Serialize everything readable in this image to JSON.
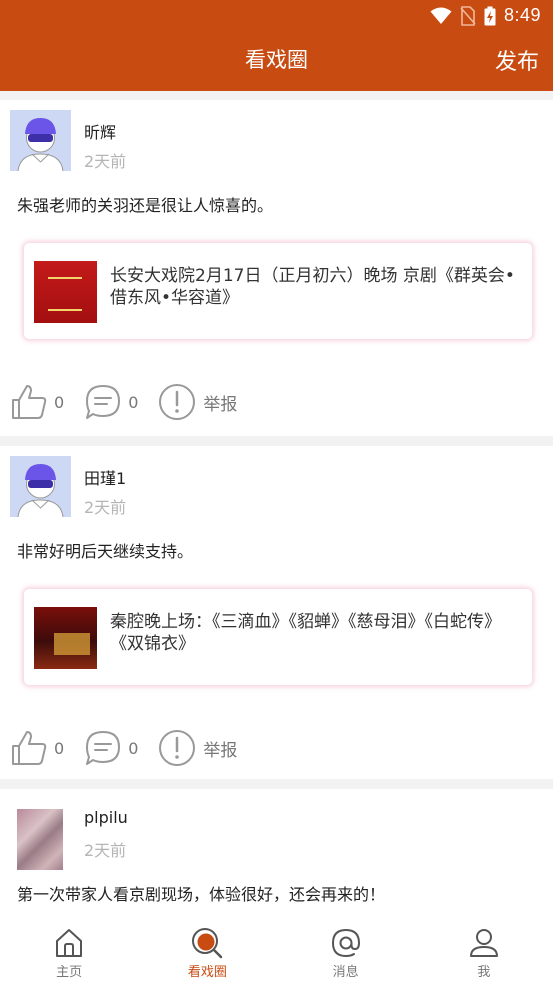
{
  "status_bar": {
    "time": "8:49"
  },
  "header": {
    "title": "看戏圈",
    "publish_label": "发布"
  },
  "posts": [
    {
      "username": "昕辉",
      "time_ago": "2天前",
      "content": "朱强老师的关羽还是很让人惊喜的。",
      "card_text": "长安大戏院2月17日（正月初六）晚场 京剧《群英会•借东风•华容道》",
      "likes": "0",
      "comments": "0",
      "report_label": "举报"
    },
    {
      "username": "田瑾1",
      "time_ago": "2天前",
      "content": "非常好明后天继续支持。",
      "card_text": "秦腔晚上场：《三滴血》《貂蝉》《慈母泪》《白蛇传》《双锦衣》",
      "likes": "0",
      "comments": "0",
      "report_label": "举报"
    },
    {
      "username": "plpilu",
      "time_ago": "2天前",
      "content": "第一次带家人看京剧现场，体验很好，还会再来的！"
    }
  ],
  "nav": {
    "home": "主页",
    "circle": "看戏圈",
    "messages": "消息",
    "me": "我"
  },
  "colors": {
    "accent": "#c84b12",
    "card_glow": "#e87896",
    "muted": "#b5b5b5"
  }
}
